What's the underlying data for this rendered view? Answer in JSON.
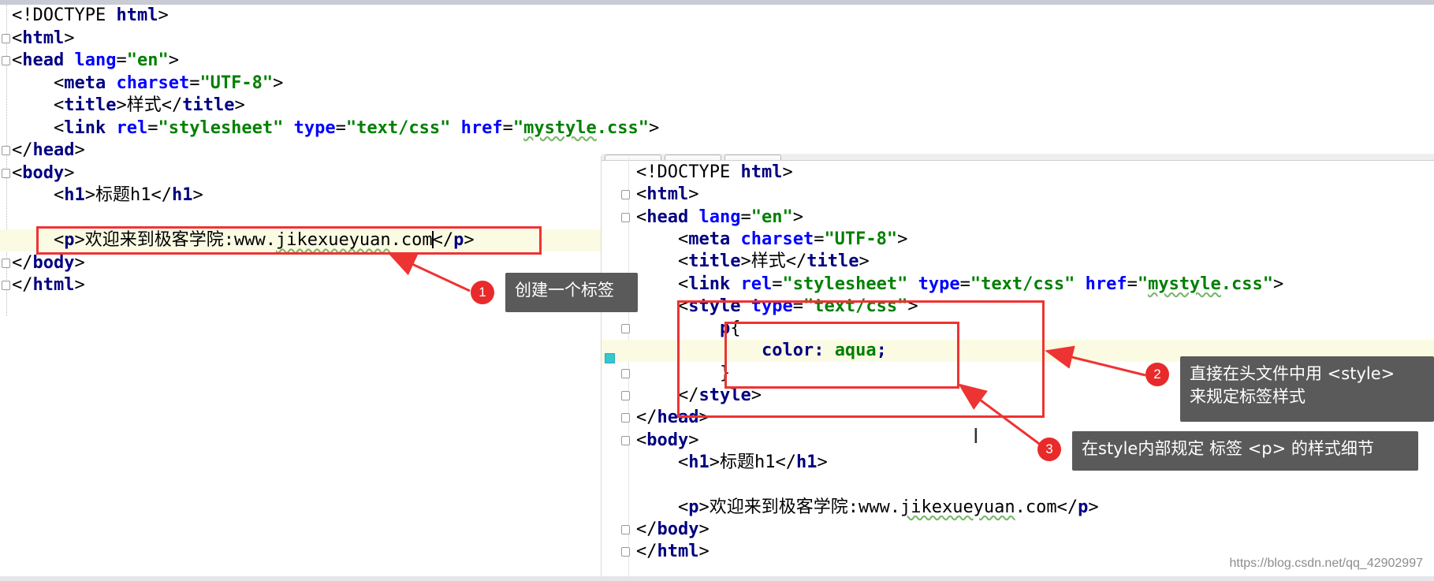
{
  "left_editor": {
    "lines": [
      {
        "fold": false,
        "html": "<span>&lt;!DOCTYPE </span><span class=\"kw\">html</span><span>&gt;</span>"
      },
      {
        "fold": true,
        "html": "<span>&lt;</span><span class=\"kw\">html</span><span>&gt;</span>"
      },
      {
        "fold": true,
        "html": "<span>&lt;</span><span class=\"kw\">head </span><span class=\"at\">lang</span><span>=</span><span class=\"st\">\"en\"</span><span>&gt;</span>"
      },
      {
        "fold": false,
        "html": "<span>    &lt;</span><span class=\"kw\">meta </span><span class=\"at\">charset</span><span>=</span><span class=\"st\">\"UTF-8\"</span><span>&gt;</span>"
      },
      {
        "fold": false,
        "html": "<span>    &lt;</span><span class=\"kw\">title</span><span>&gt;样式&lt;/</span><span class=\"kw\">title</span><span>&gt;</span>"
      },
      {
        "fold": false,
        "html": "<span>    &lt;</span><span class=\"kw\">link </span><span class=\"at\">rel</span><span>=</span><span class=\"st\">\"stylesheet\" </span><span class=\"at\">type</span><span>=</span><span class=\"st\">\"text/css\" </span><span class=\"at\">href</span><span>=</span><span class=\"st\">\"<span class=\"sq\">mystyle</span>.css\"</span><span>&gt;</span>"
      },
      {
        "fold": true,
        "html": "<span>&lt;/</span><span class=\"kw\">head</span><span>&gt;</span>"
      },
      {
        "fold": true,
        "html": "<span>&lt;</span><span class=\"kw\">body</span><span>&gt;</span>"
      },
      {
        "fold": false,
        "html": "<span>    &lt;</span><span class=\"kw\">h1</span><span>&gt;标题h1&lt;/</span><span class=\"kw\">h1</span><span>&gt;</span>"
      },
      {
        "fold": false,
        "html": ""
      },
      {
        "fold": false,
        "highlight": true,
        "html": "<span>    &lt;</span><span class=\"kw\">p</span><span>&gt;欢迎来到极客学院:www.<span class=\"sq\">jikexueyuan</span>.com<span class=\"caret\"></span>&lt;/</span><span class=\"kw\">p</span><span>&gt;</span>"
      },
      {
        "fold": true,
        "html": "<span>&lt;/</span><span class=\"kw\">body</span><span>&gt;</span>"
      },
      {
        "fold": true,
        "html": "<span>&lt;/</span><span class=\"kw\">html</span><span>&gt;</span>"
      }
    ]
  },
  "right_editor": {
    "lines": [
      {
        "fold": false,
        "html": "<span>&lt;!DOCTYPE </span><span class=\"kw\">html</span><span>&gt;</span>"
      },
      {
        "fold": true,
        "html": "<span>&lt;</span><span class=\"kw\">html</span><span>&gt;</span>"
      },
      {
        "fold": true,
        "html": "<span>&lt;</span><span class=\"kw\">head </span><span class=\"at\">lang</span><span>=</span><span class=\"st\">\"en\"</span><span>&gt;</span>"
      },
      {
        "fold": false,
        "html": "<span>    &lt;</span><span class=\"kw\">meta </span><span class=\"at\">charset</span><span>=</span><span class=\"st\">\"UTF-8\"</span><span>&gt;</span>"
      },
      {
        "fold": false,
        "html": "<span>    &lt;</span><span class=\"kw\">title</span><span>&gt;样式&lt;/</span><span class=\"kw\">title</span><span>&gt;</span>"
      },
      {
        "fold": false,
        "html": "<span>    &lt;</span><span class=\"kw\">link </span><span class=\"at\">rel</span><span>=</span><span class=\"st\">\"stylesheet\" </span><span class=\"at\">type</span><span>=</span><span class=\"st\">\"text/css\" </span><span class=\"at\">href</span><span>=</span><span class=\"st\">\"<span class=\"sq\">mystyle</span>.css\"</span><span>&gt;</span>"
      },
      {
        "fold": true,
        "html": "<span>    &lt;</span><span class=\"kw\">style </span><span class=\"at\">type</span><span>=</span><span class=\"st\">\"text/css\"</span><span>&gt;</span>"
      },
      {
        "fold": true,
        "html": "<span>        </span><span class=\"pr\">p</span><span>{</span>"
      },
      {
        "fold": false,
        "highlight": true,
        "html": "<span>            </span><span class=\"pr\">color</span><span class=\"pr\">: </span><span class=\"vl\">aqua</span><span class=\"pr\">;</span>"
      },
      {
        "fold": true,
        "html": "<span>        }</span>"
      },
      {
        "fold": true,
        "html": "<span>    &lt;/</span><span class=\"kw\">style</span><span>&gt;</span>"
      },
      {
        "fold": true,
        "html": "<span>&lt;/</span><span class=\"kw\">head</span><span>&gt;</span>"
      },
      {
        "fold": true,
        "html": "<span>&lt;</span><span class=\"kw\">body</span><span>&gt;</span>"
      },
      {
        "fold": false,
        "html": "<span>    &lt;</span><span class=\"kw\">h1</span><span>&gt;标题h1&lt;/</span><span class=\"kw\">h1</span><span>&gt;</span>"
      },
      {
        "fold": false,
        "html": ""
      },
      {
        "fold": false,
        "html": "<span>    &lt;</span><span class=\"kw\">p</span><span>&gt;欢迎来到极客学院:www.<span class=\"sq\">jikexueyuan</span>.com&lt;/</span><span class=\"kw\">p</span><span>&gt;</span>"
      },
      {
        "fold": true,
        "html": "<span>&lt;/</span><span class=\"kw\">body</span><span>&gt;</span>"
      },
      {
        "fold": true,
        "html": "<span>&lt;/</span><span class=\"kw\">html</span><span>&gt;</span>"
      }
    ]
  },
  "annotations": {
    "a1": {
      "badge": "1",
      "text": "创建一个标签"
    },
    "a2": {
      "badge": "2",
      "text_line1": "直接在头文件中用 <style>",
      "text_line2": "来规定标签样式"
    },
    "a3": {
      "badge": "3",
      "text": "在style内部规定 标签 <p> 的样式细节"
    }
  },
  "watermark": "https://blog.csdn.net/qq_42902997",
  "colors": {
    "accent_red": "#ee3333",
    "callout_bg": "#5a5a5a",
    "tag_keyword": "#000080",
    "attribute": "#0000ff",
    "string": "#008000"
  }
}
